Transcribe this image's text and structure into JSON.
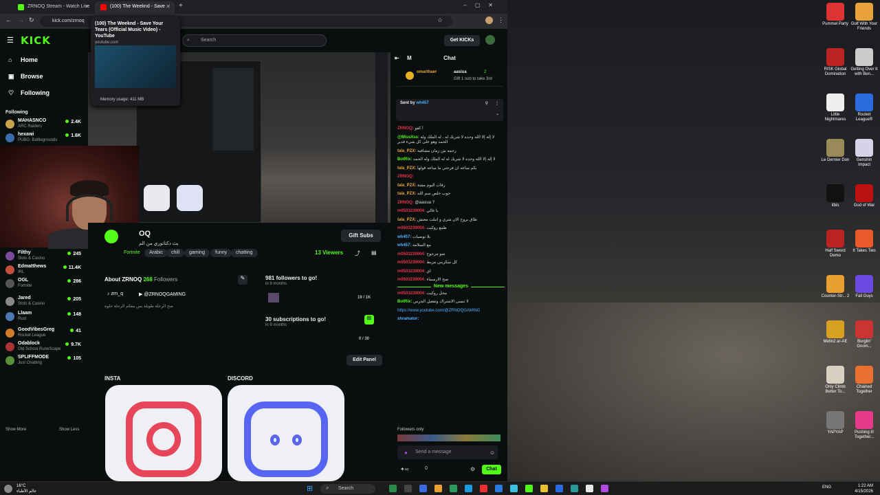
{
  "tabs": [
    {
      "label": "ZRNOQ Stream - Watch Live o"
    },
    {
      "label": "(100) The Weeknd - Save Your"
    }
  ],
  "tab_preview": {
    "title": "(100) The Weeknd - Save Your Tears (Official Music Video) - YouTube",
    "domain": "youtube.com",
    "memory": "Memory usage: 411 MB"
  },
  "address": {
    "url": "kick.com/zrnoq"
  },
  "kick": {
    "logo": "KICK",
    "search_placeholder": "Search",
    "get_kicks": "Get KICKs"
  },
  "nav": [
    {
      "label": "Home"
    },
    {
      "label": "Browse"
    },
    {
      "label": "Following"
    }
  ],
  "following_header": "Following",
  "following": [
    {
      "name": "MAHASNCO",
      "game": "ARC Raiders",
      "viewers": "2.4K",
      "color": "#c9a24a"
    },
    {
      "name": "hexawi",
      "game": "PUBG: Battlegrounds",
      "viewers": "1.6K",
      "color": "#3b6ea8"
    },
    {
      "name": "Filthy",
      "game": "Slots & Casino",
      "viewers": "245",
      "color": "#7b4c9e"
    },
    {
      "name": "Edmatthews",
      "game": "IRL",
      "viewers": "11.4K",
      "color": "#c0503c"
    },
    {
      "name": "OGL",
      "game": "Fortnite",
      "viewers": "286",
      "color": "#555"
    },
    {
      "name": "Jared",
      "game": "Slots & Casino",
      "viewers": "205",
      "color": "#888"
    },
    {
      "name": "Llaam",
      "game": "Rust",
      "viewers": "148",
      "color": "#4a7ab0"
    },
    {
      "name": "GoodVibesGreg",
      "game": "Rocket League",
      "viewers": "41",
      "color": "#d07a2a"
    },
    {
      "name": "Odablock",
      "game": "Old School RuneScape",
      "viewers": "9.7K",
      "color": "#a33"
    },
    {
      "name": "SPLIFFMODE",
      "game": "Just Chatting",
      "viewers": "105",
      "color": "#5a8f3a"
    }
  ],
  "show_more": "Show More",
  "show_less": "Show Less",
  "channel": {
    "name": "OQ",
    "title": "بث دكتاتوري من الم",
    "category": "Fortnite",
    "tags": [
      "Arabic",
      "chill",
      "gaming",
      "funny",
      "chatting"
    ],
    "viewers": "13 Viewers",
    "gift_subs": "Gift Subs"
  },
  "about": {
    "heading": "About ZRNOQ",
    "followers_count": "268",
    "followers_label": "Followers",
    "tiktok": "zrn_q",
    "youtube": "@ZRNOQGAMING",
    "bio": "صح الرحلة طويلة بس معكم الرحلة حلوة"
  },
  "goals": [
    {
      "title": "981 followers to go!",
      "sub": "in 9 months",
      "progress": "19 / 1K"
    },
    {
      "title": "30 subscriptions to go!",
      "sub": "in 9 months",
      "progress": "0 / 30"
    }
  ],
  "edit_panel": "Edit Panel",
  "panels": [
    {
      "heading": "INSTA"
    },
    {
      "heading": "DISCORD"
    }
  ],
  "chat": {
    "header": "Chat",
    "pinned_user": "omarthaer",
    "pinned_user2": "aasiua",
    "pinned_count": "2",
    "pinned_text": "Gift 1 sub to take 3rd",
    "sent_by_label": "Sent by",
    "sent_by_user": "wh457",
    "messages": [
      {
        "user": "ZRNOQ",
        "text": "كفو !",
        "color": "#e8344b"
      },
      {
        "user": "@MissXss",
        "text": "لا إله إلا الله وحده لا شريك له ، له الملك وله الحمد وهو على كل شيء قدير",
        "color": "#53fc18"
      },
      {
        "user": "tala_PZX",
        "text": "رحمه من زمان مشافيه",
        "color": "#e8a83b"
      },
      {
        "user": "BotRix",
        "text": "لا إله إلا الله وحده لا شريك له له الملك وله الحمد",
        "color": "#53fc18"
      },
      {
        "user": "tala_PZX",
        "text": "بكم ساعه ان فرحتي ما ساعه قولها",
        "color": "#e8a83b"
      },
      {
        "user": "ZRNOQ",
        "text": "",
        "color": "#e8344b"
      },
      {
        "user": "tala_PZX",
        "text": "رقات اليوم مشة",
        "color": "#e8a83b"
      },
      {
        "user": "tala_PZX",
        "text": "خوب خلص سم الله",
        "color": "#e8a83b"
      },
      {
        "user": "ZRNOQ",
        "text": "@aasiua ?",
        "color": "#e8344b"
      },
      {
        "user": "m0503239004",
        "text": "يا غالي",
        "color": "#e8344b"
      },
      {
        "user": "tala_PZX",
        "text": "طاق بروح الان شري و اتبلت معتش",
        "color": "#e8a83b"
      },
      {
        "user": "m0503239004",
        "text": "طمع روكيت",
        "color": "#e8344b"
      },
      {
        "user": "wh457",
        "text": "يلا توصيات",
        "color": "#4bb3ff"
      },
      {
        "user": "wh457",
        "text": "مع السلامه",
        "color": "#4bb3ff"
      },
      {
        "user": "m0503239004",
        "text": "شو مرحوح",
        "color": "#e8344b"
      },
      {
        "user": "m0503239004",
        "text": "كل سكربتي مزبط",
        "color": "#e8344b"
      },
      {
        "user": "m0503239004",
        "text": "اي",
        "color": "#e8344b"
      },
      {
        "user": "m0503239004",
        "text": "صح الارسماء",
        "color": "#e8344b"
      }
    ],
    "new_messages": "New messages",
    "after": [
      {
        "user": "m0503239004",
        "text": "محل روكيت",
        "color": "#e8344b"
      },
      {
        "user": "BotRix",
        "text": "لا تنسى الاشتراك وتفعيل الجرس",
        "color": "#53fc18"
      },
      {
        "user": "",
        "text": "https://www.youtube.com/@ZRNOQGAMING",
        "color": "#4bb3ff"
      },
      {
        "user": "shramator",
        "text": "",
        "color": "#4bb3ff"
      }
    ],
    "followers_only": "Followers only",
    "input_placeholder": "Send a message",
    "send_label": "Chat",
    "points": "0"
  },
  "desktop_icons": [
    {
      "label": "Pummel Party",
      "color": "#d33"
    },
    {
      "label": "Golf With Your Friends",
      "color": "#e9a13a"
    },
    {
      "label": "RISK Global Domination",
      "color": "#b22"
    },
    {
      "label": "Getting Over It with Ben...",
      "color": "#ccc"
    },
    {
      "label": "Little Nightmares",
      "color": "#eee"
    },
    {
      "label": "Rocket League®",
      "color": "#2a6be0"
    },
    {
      "label": "Le Dernier Don",
      "color": "#9a8a5a"
    },
    {
      "label": "Genshin Impact",
      "color": "#d8d2e8"
    },
    {
      "label": "itbis",
      "color": "#111"
    },
    {
      "label": "God of War",
      "color": "#b11"
    },
    {
      "label": "Half Sword Demo",
      "color": "#b22"
    },
    {
      "label": "It Takes Two",
      "color": "#e85a2a"
    },
    {
      "label": "Counter-Str... 2",
      "color": "#e8a030"
    },
    {
      "label": "Fall Guys",
      "color": "#6a4ae0"
    },
    {
      "label": "Metin2 ar-AE",
      "color": "#d8a020"
    },
    {
      "label": "Burglin' Gnom...",
      "color": "#c33"
    },
    {
      "label": "Only Climb Better To...",
      "color": "#d8d0c0"
    },
    {
      "label": "Chained Together",
      "color": "#e87030"
    },
    {
      "label": "YAPYAP",
      "color": "#777"
    },
    {
      "label": "Pushing it! Together...",
      "color": "#e83a8a"
    }
  ],
  "taskbar": {
    "search": "Search",
    "weather_temp": "16°C",
    "weather_desc": "عالم الأطباء",
    "lang": "ENG",
    "time": "1:22 AM",
    "date": "4/15/2026"
  }
}
